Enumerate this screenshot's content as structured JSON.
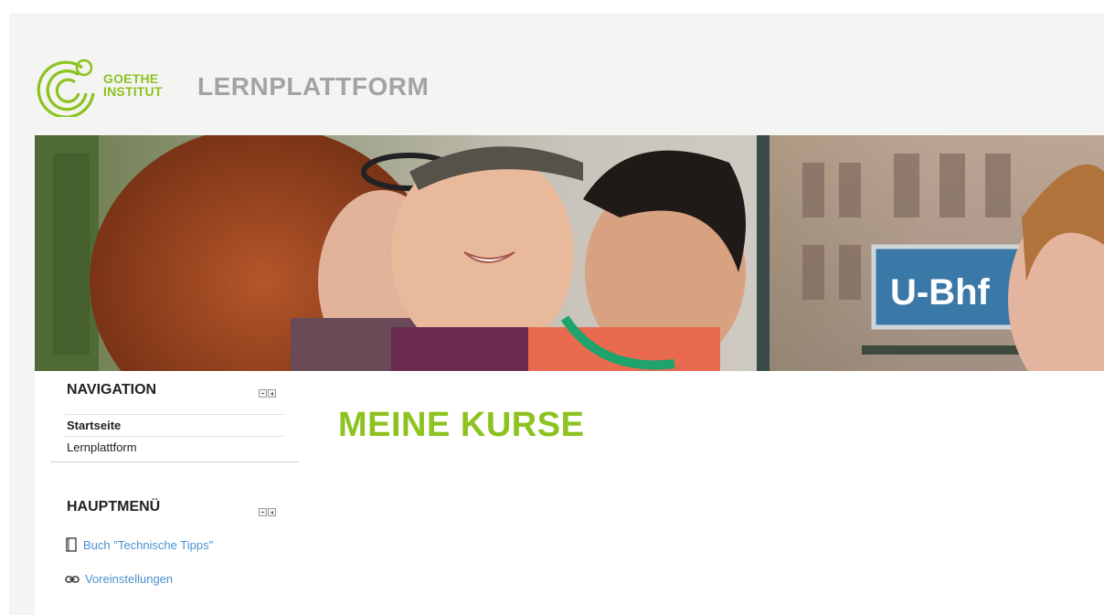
{
  "header": {
    "logo_line1": "GOETHE",
    "logo_line2": "INSTITUT",
    "app_title": "LERNPLATTFORM"
  },
  "navigation": {
    "title": "NAVIGATION",
    "items": [
      {
        "label": "Startseite"
      },
      {
        "label": "Lernplattform"
      }
    ]
  },
  "main_menu": {
    "title": "HAUPTMENÜ",
    "items": [
      {
        "label": "Buch \"Technische Tipps\"",
        "icon": "book-icon"
      },
      {
        "label": "Voreinstellungen",
        "icon": "link-icon"
      }
    ]
  },
  "main": {
    "title": "MEINE KURSE"
  },
  "banner": {
    "sign_text": "U-Bhf"
  },
  "colors": {
    "brand_green": "#8cc31f",
    "link_blue": "#4a90cf",
    "header_bg": "#f4f4f2"
  }
}
